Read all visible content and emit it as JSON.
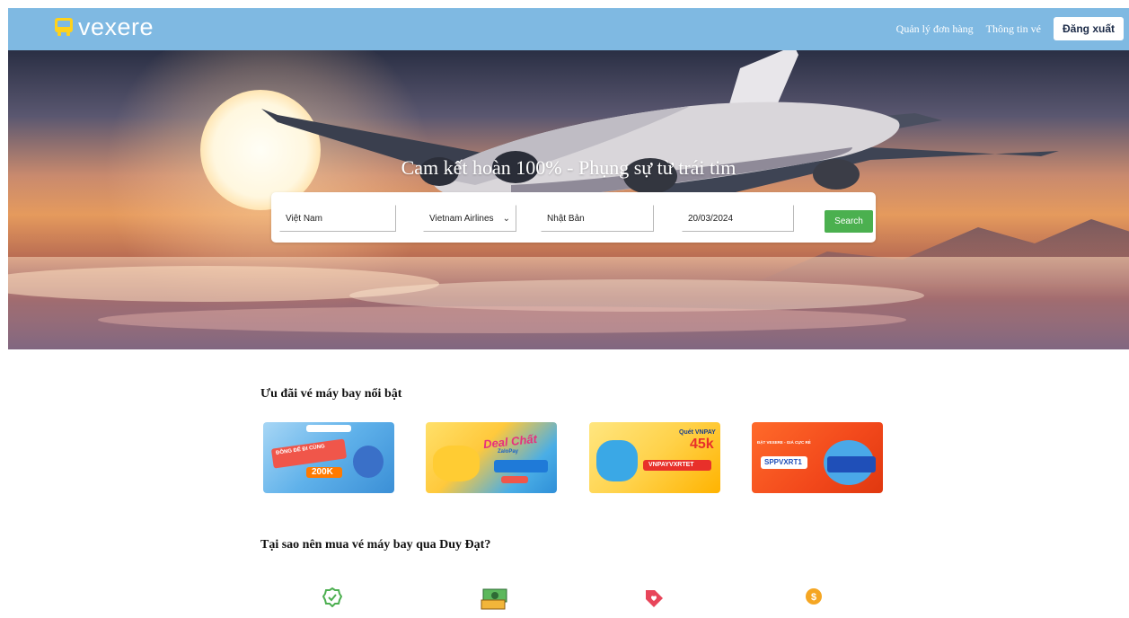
{
  "brand": {
    "name": "vexere",
    "logo_color": "#ffd21a",
    "nav_color": "#7fb9e2"
  },
  "nav": {
    "links": [
      "Quản lý đơn hàng",
      "Thông tin vé"
    ],
    "logout_label": "Đăng xuất"
  },
  "hero": {
    "title": "Cam kết hoàn 100% - Phụng sự từ trái tim"
  },
  "search": {
    "origin_value": "Việt Nam",
    "airline_selected": "Vietnam Airlines",
    "destination_value": "Nhật Bản",
    "date_value": "20/03/2024",
    "button_label": "Search",
    "button_color": "#4bb04f"
  },
  "deals": {
    "title": "Ưu đãi vé máy bay nổi bật",
    "banners": [
      {
        "text_a": "ĐỒNG ĐỂ ĐI CÙNG",
        "text_b": "200K"
      },
      {
        "text_a": "Deal Chất",
        "text_b": "ZaloPay"
      },
      {
        "text_a": "Quét VNPAY",
        "text_b": "45k",
        "text_c": "VNPAYVXRTET"
      },
      {
        "text_a": "ĐẶT VEXERE - GIÁ CỰC RẺ",
        "text_b": "SPPVXRT1"
      }
    ]
  },
  "why": {
    "title": "Tại sao nên mua vé máy bay qua Duy Đạt?",
    "items": [
      {
        "icon": "check-badge-icon",
        "color": "#4caf50"
      },
      {
        "icon": "money-icon",
        "color": "#3a9a4a"
      },
      {
        "icon": "price-tag-icon",
        "color": "#e8455a"
      },
      {
        "icon": "coin-hand-icon",
        "color": "#f5a623"
      }
    ]
  }
}
